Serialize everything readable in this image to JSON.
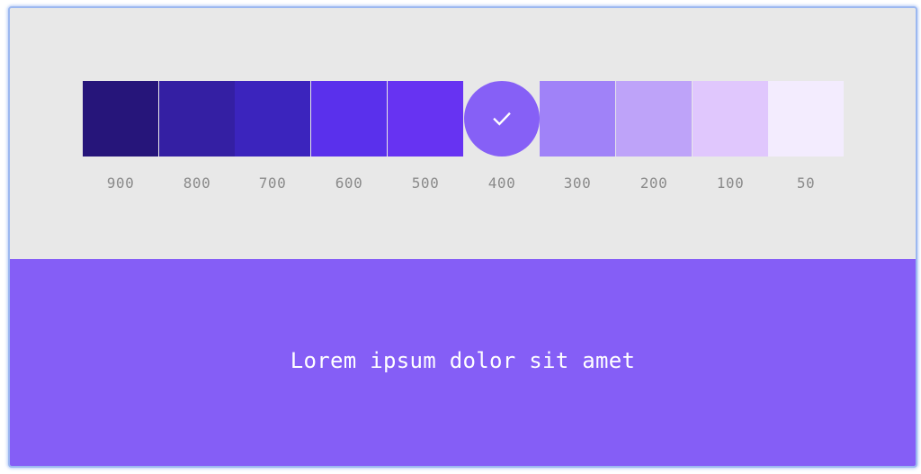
{
  "palette": {
    "selected_index": 5,
    "swatches": [
      {
        "label": "900",
        "color": "#26157a"
      },
      {
        "label": "800",
        "color": "#341fa3"
      },
      {
        "label": "700",
        "color": "#3b24bd"
      },
      {
        "label": "600",
        "color": "#5a30ec"
      },
      {
        "label": "500",
        "color": "#6733f2"
      },
      {
        "label": "400",
        "color": "#8660f6"
      },
      {
        "label": "300",
        "color": "#a082f8"
      },
      {
        "label": "200",
        "color": "#bea3f9"
      },
      {
        "label": "100",
        "color": "#e0c7fd"
      },
      {
        "label": "50",
        "color": "#f3ecfe"
      }
    ],
    "background": "#e8e8e8",
    "label_color": "#8a8a8a",
    "selected_icon": "check-icon"
  },
  "preview": {
    "text": "Lorem ipsum dolor sit amet",
    "background": "#855ef6",
    "text_color": "#ffffff"
  }
}
